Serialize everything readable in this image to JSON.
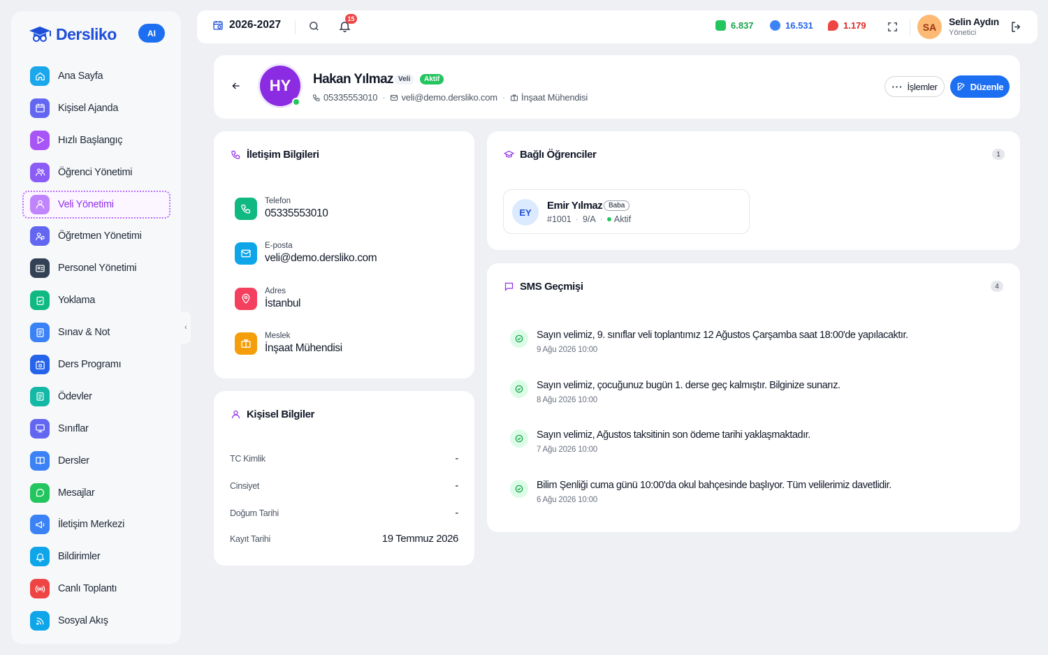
{
  "app": {
    "logo_text": "Dersliko",
    "ai_badge": "AI"
  },
  "sidebar": {
    "items": [
      {
        "label": "Ana Sayfa",
        "icon": "home-icon",
        "color": "#1aa7ec"
      },
      {
        "label": "Kişisel Ajanda",
        "icon": "calendar-icon",
        "color": "#6366f1"
      },
      {
        "label": "Hızlı Başlangıç",
        "icon": "play-icon",
        "color": "#a855f7"
      },
      {
        "label": "Öğrenci Yönetimi",
        "icon": "users-icon",
        "color": "#8b5cf6"
      },
      {
        "label": "Veli Yönetimi",
        "icon": "user-group-icon",
        "color": "#c084fc"
      },
      {
        "label": "Öğretmen Yönetimi",
        "icon": "teacher-icon",
        "color": "#6366f1"
      },
      {
        "label": "Personel Yönetimi",
        "icon": "id-card-icon",
        "color": "#334155"
      },
      {
        "label": "Yoklama",
        "icon": "clipboard-check-icon",
        "color": "#10b981"
      },
      {
        "label": "Sınav & Not",
        "icon": "exam-icon",
        "color": "#3b82f6"
      },
      {
        "label": "Ders Programı",
        "icon": "schedule-icon",
        "color": "#2563eb"
      },
      {
        "label": "Ödevler",
        "icon": "homework-icon",
        "color": "#14b8a6"
      },
      {
        "label": "Sınıflar",
        "icon": "monitor-icon",
        "color": "#6366f1"
      },
      {
        "label": "Dersler",
        "icon": "book-icon",
        "color": "#3b82f6"
      },
      {
        "label": "Mesajlar",
        "icon": "message-icon",
        "color": "#22c55e"
      },
      {
        "label": "İletişim Merkezi",
        "icon": "megaphone-icon",
        "color": "#3b82f6"
      },
      {
        "label": "Bildirimler",
        "icon": "bell-icon",
        "color": "#0ea5e9"
      },
      {
        "label": "Canlı Toplantı",
        "icon": "broadcast-icon",
        "color": "#ef4444"
      },
      {
        "label": "Sosyal Akış",
        "icon": "rss-icon",
        "color": "#0ea5e9"
      }
    ],
    "active_index": 4
  },
  "topbar": {
    "year": "2026-2027",
    "notification_count": "15",
    "stats": [
      {
        "value": "6.837",
        "color": "#16a34a",
        "icon": "money-icon"
      },
      {
        "value": "16.531",
        "color": "#2563eb",
        "icon": "gem-icon"
      },
      {
        "value": "1.179",
        "color": "#dc2626",
        "icon": "fire-icon"
      }
    ],
    "user": {
      "initials": "SA",
      "name": "Selin Aydın",
      "role": "Yönetici"
    }
  },
  "header": {
    "initials": "HY",
    "name": "Hakan Yılmaz",
    "role_tag": "Veli",
    "status_tag": "Aktif",
    "phone": "05335553010",
    "email": "veli@demo.dersliko.com",
    "job": "İnşaat Mühendisi",
    "actions_label": "İşlemler",
    "edit_label": "Düzenle"
  },
  "contact": {
    "title": "İletişim Bilgileri",
    "rows": [
      {
        "label": "Telefon",
        "value": "05335553010",
        "icon": "phone-icon",
        "color": "#10b981"
      },
      {
        "label": "E-posta",
        "value": "veli@demo.dersliko.com",
        "icon": "mail-icon",
        "color": "#0ea5e9"
      },
      {
        "label": "Adres",
        "value": "İstanbul",
        "icon": "location-icon",
        "color": "#f43f5e"
      },
      {
        "label": "Meslek",
        "value": "İnşaat Mühendisi",
        "icon": "briefcase-icon",
        "color": "#f59e0b"
      }
    ]
  },
  "personal": {
    "title": "Kişisel Bilgiler",
    "rows": [
      {
        "label": "TC Kimlik",
        "value": "-"
      },
      {
        "label": "Cinsiyet",
        "value": "-"
      },
      {
        "label": "Doğum Tarihi",
        "value": "-"
      },
      {
        "label": "Kayıt Tarihi",
        "value": "19 Temmuz 2026"
      }
    ]
  },
  "students": {
    "title": "Bağlı Öğrenciler",
    "count": "1",
    "items": [
      {
        "initials": "EY",
        "name": "Emir Yılmaz",
        "relation": "Baba",
        "number": "#1001",
        "class": "9/A",
        "status": "Aktif"
      }
    ]
  },
  "sms": {
    "title": "SMS Geçmişi",
    "count": "4",
    "items": [
      {
        "text": "Sayın velimiz, 9. sınıflar veli toplantımız 12 Ağustos Çarşamba saat 18:00'de yapılacaktır.",
        "date": "9 Ağu 2026 10:00"
      },
      {
        "text": "Sayın velimiz, çocuğunuz bugün 1. derse geç kalmıştır. Bilginize sunarız.",
        "date": "8 Ağu 2026 10:00"
      },
      {
        "text": "Sayın velimiz, Ağustos taksitinin son ödeme tarihi yaklaşmaktadır.",
        "date": "7 Ağu 2026 10:00"
      },
      {
        "text": "Bilim Şenliği cuma günü 10:00'da okul bahçesinde başlıyor. Tüm velilerimiz davetlidir.",
        "date": "6 Ağu 2026 10:00"
      }
    ]
  }
}
